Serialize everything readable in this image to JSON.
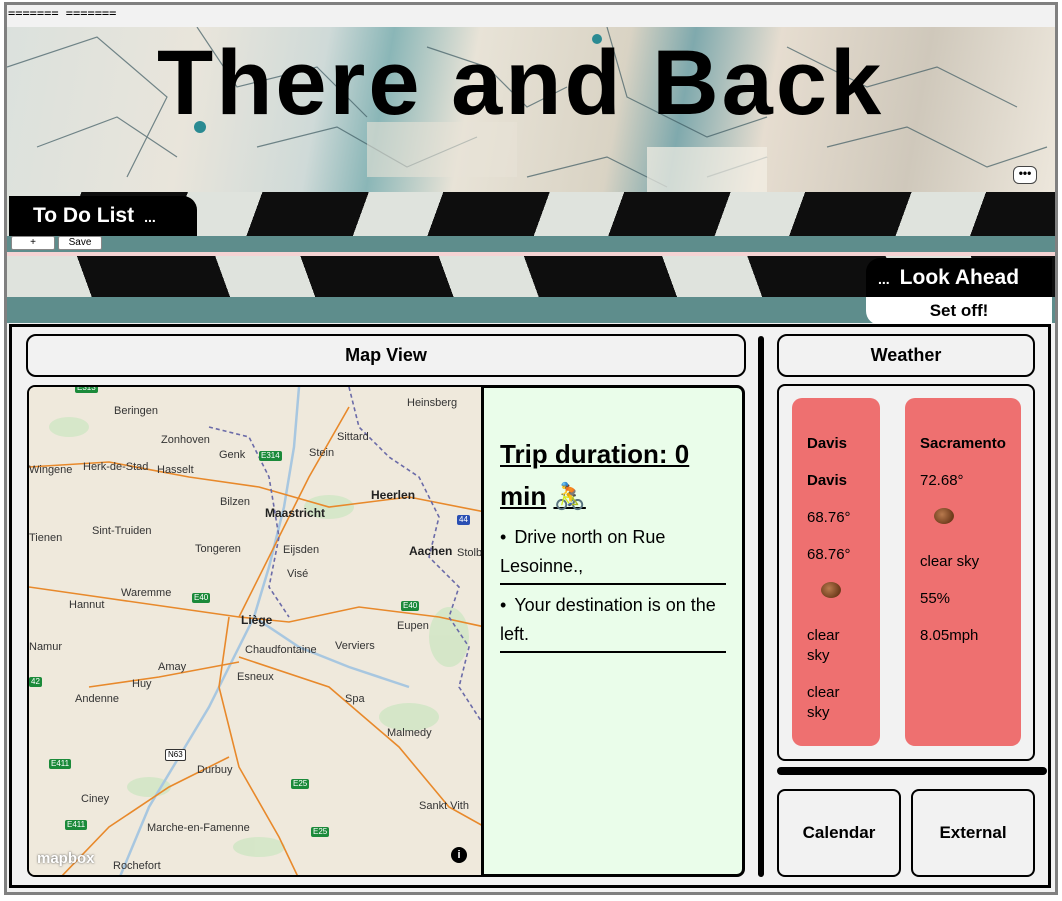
{
  "dev_text": "======= =======",
  "banner": {
    "title": "There and Back",
    "more_label": "•••"
  },
  "todo": {
    "tab_label": "To Do List",
    "tab_dots": "...",
    "add_label": "+",
    "save_label": "Save"
  },
  "look_ahead": {
    "tab_label": "Look Ahead",
    "tab_dots": "...",
    "setoff_label": "Set off!"
  },
  "map_view": {
    "header": "Map View",
    "attribution": "mapbox",
    "info_label": "i",
    "places": [
      "Beringen",
      "Heinsberg",
      "Zonhoven",
      "Sittard",
      "Genk",
      "Stein",
      "Herk-de-Stad",
      "Hasselt",
      "Wingene",
      "Heerlen",
      "Bilzen",
      "Maastricht",
      "Sint-Truiden",
      "Tienen",
      "Tongeren",
      "Eijsden",
      "Aachen",
      "Stolb",
      "Visé",
      "Waremme",
      "Hannut",
      "Liège",
      "Eupen",
      "Chaudfontaine",
      "Verviers",
      "Amay",
      "Esneux",
      "Huy",
      "Andenne",
      "Spa",
      "Malmedy",
      "Durbuy",
      "Ciney",
      "Sankt Vith",
      "Marche-en-Famenne",
      "Rochefort",
      "Namur"
    ],
    "roads": [
      "E314",
      "E40",
      "E40",
      "N63",
      "E25",
      "E25",
      "E411",
      "E411",
      "44",
      "E313",
      "42"
    ]
  },
  "directions": {
    "title_line1": "Trip duration: 0",
    "title_line2": "min",
    "title_icon": "🚴",
    "steps": [
      "Drive north on Rue Lesoinne.,",
      "Your destination is on the left."
    ]
  },
  "weather": {
    "header": "Weather",
    "cards": [
      {
        "lines": [
          "Davis",
          "Davis",
          "68.76°",
          "68.76°",
          "",
          "clear sky",
          "clear sky"
        ]
      },
      {
        "lines": [
          "Sacramento",
          "72.68°",
          "",
          "clear sky",
          "55%",
          "8.05mph"
        ]
      }
    ]
  },
  "buttons": {
    "calendar": "Calendar",
    "external": "External"
  },
  "colors": {
    "teal": "#5e8d8c",
    "card": "#ee7070",
    "directions_bg": "#eafdea",
    "panel_bg": "#f2f2f2"
  }
}
